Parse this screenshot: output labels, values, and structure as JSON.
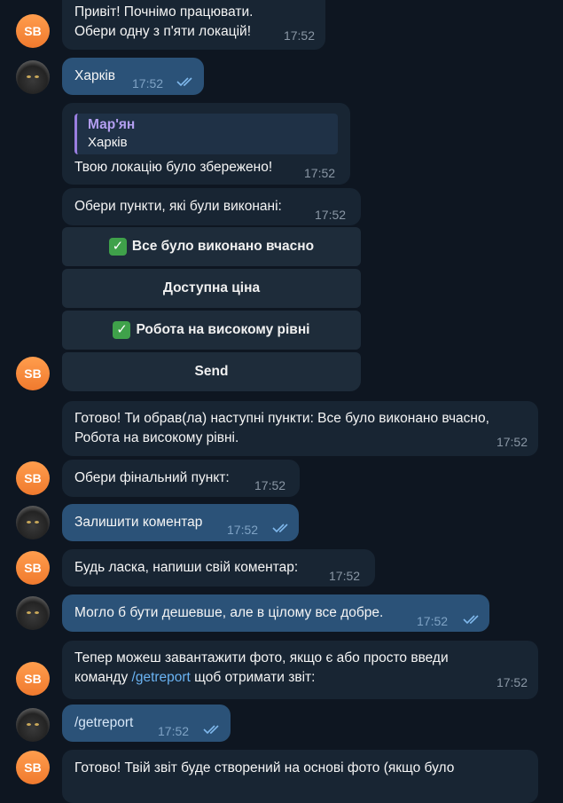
{
  "bot_avatar_initials": "SB",
  "messages": [
    {
      "text1": "Привіт! Почнімо працювати.",
      "text2": "Обери одну з п'яти локацій!",
      "time": "17:52"
    },
    {
      "text": "Харків",
      "time": "17:52"
    },
    {
      "reply_name": "Мар'ян",
      "reply_text": "Харків",
      "text": "Твою локацію було збережено!",
      "time": "17:52"
    },
    {
      "text": "Обери пункти, які були виконані:",
      "time": "17:52"
    },
    {
      "text1": "Готово! Ти обрав(ла) наступні пункти: Все було виконано вчасно,",
      "text2": "Робота на високому рівні.",
      "time": "17:52"
    },
    {
      "text": "Обери фінальний пункт:",
      "time": "17:52"
    },
    {
      "text": "Залишити коментар",
      "time": "17:52"
    },
    {
      "text": "Будь ласка, напиши свій коментар:",
      "time": "17:52"
    },
    {
      "text": "Могло б бути дешевше, але в цілому все добре.",
      "time": "17:52"
    },
    {
      "text1": "Тепер можеш завантажити фото, якщо є або просто введи",
      "text2_pre": "команду ",
      "command": "/getreport",
      "text2_post": " щоб отримати звіт:",
      "time": "17:52"
    },
    {
      "text": "/getreport",
      "time": "17:52"
    },
    {
      "text1": "Готово! Твій звіт буде створений на основі фото (якщо було"
    }
  ],
  "keyboard": {
    "buttons": [
      {
        "check": "✓",
        "label": "Все було виконано вчасно"
      },
      {
        "check": "",
        "label": "Доступна ціна"
      },
      {
        "check": "✓",
        "label": "Робота на високому рівні"
      },
      {
        "check": "",
        "label": "Send"
      }
    ]
  },
  "colors": {
    "background": "#0e1621",
    "incoming_bubble": "#182533",
    "outgoing_bubble": "#2b5278",
    "link": "#6ab3f3",
    "reply_accent": "#9a7ee0",
    "avatar": "#f07a2e",
    "check": "#3fa14a"
  },
  "icons": {
    "read_receipt": "double-check-icon",
    "user_avatar": "cat-avatar-icon"
  }
}
